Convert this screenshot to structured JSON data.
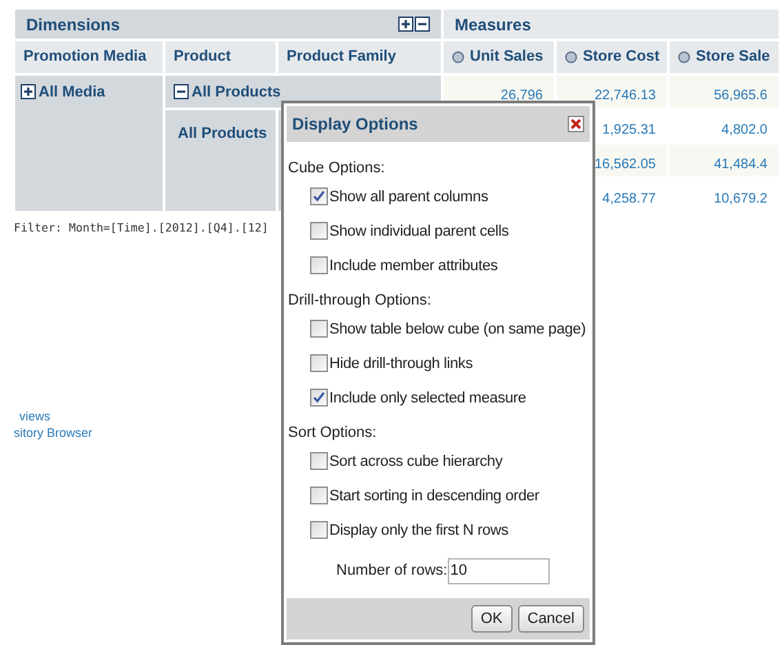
{
  "header": {
    "dimensions": "Dimensions",
    "measures": "Measures"
  },
  "columns": [
    {
      "label": "Promotion Media",
      "kind": "dimension"
    },
    {
      "label": "Product",
      "kind": "dimension"
    },
    {
      "label": "Product Family",
      "kind": "dimension"
    },
    {
      "label": "Unit Sales",
      "kind": "measure"
    },
    {
      "label": "Store Cost",
      "kind": "measure"
    },
    {
      "label": "Store Sale",
      "kind": "measure"
    }
  ],
  "media": {
    "label": "All Media",
    "expanded": false
  },
  "product": {
    "label": "All Products",
    "expanded": true
  },
  "product_child": "All Products",
  "rows": [
    {
      "unit_sales": "26,796",
      "store_cost": "22,746.13",
      "store_sales": "56,965.6"
    },
    {
      "store_cost": "1,925.31",
      "store_sales": "4,802.0"
    },
    {
      "store_cost": "16,562.05",
      "store_sales": "41,484.4"
    },
    {
      "store_cost": "4,258.77",
      "store_sales": "10,679.2"
    }
  ],
  "filter": "Filter: Month=[Time].[2012].[Q4].[12]",
  "links": [
    "views",
    "sitory Browser"
  ],
  "dialog": {
    "title": "Display Options",
    "sections": [
      {
        "title": "Cube Options:",
        "items": [
          {
            "kind": "checkbox",
            "label": "Show all parent columns",
            "checked": true
          },
          {
            "kind": "checkbox",
            "label": "Show individual parent cells",
            "checked": false
          },
          {
            "kind": "checkbox",
            "label": "Include member attributes",
            "checked": false
          }
        ]
      },
      {
        "title": "Drill-through Options:",
        "items": [
          {
            "kind": "checkbox",
            "label": "Show table below cube (on same page)",
            "checked": false
          },
          {
            "kind": "checkbox",
            "label": "Hide drill-through links",
            "checked": false
          },
          {
            "kind": "checkbox",
            "label": "Include only selected measure",
            "checked": true
          }
        ]
      },
      {
        "title": "Sort Options:",
        "items": [
          {
            "kind": "checkbox",
            "label": "Sort across cube hierarchy",
            "checked": false
          },
          {
            "kind": "checkbox",
            "label": "Start sorting in descending order",
            "checked": false
          },
          {
            "kind": "checkbox",
            "label": "Display only the first N rows",
            "checked": false
          },
          {
            "kind": "number",
            "label": "Number of rows:",
            "value": "10"
          }
        ]
      }
    ],
    "buttons": [
      "OK",
      "Cancel"
    ]
  }
}
